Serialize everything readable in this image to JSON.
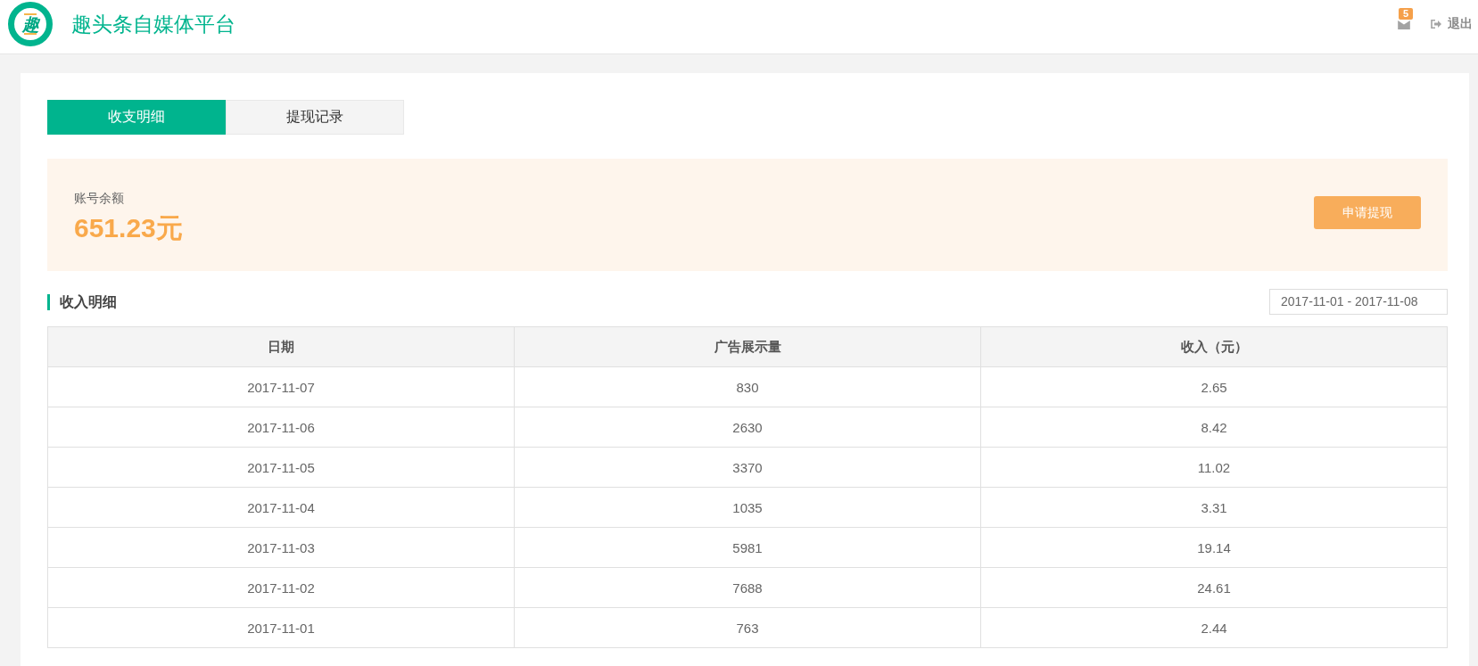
{
  "header": {
    "logo": "趣",
    "title": "趣头条自媒体平台",
    "notifications": {
      "count": "5"
    },
    "logout": "退出"
  },
  "tabs": [
    {
      "label": "收支明细",
      "selected": true
    },
    {
      "label": "提现记录",
      "selected": false
    }
  ],
  "balance": {
    "label": "账号余额",
    "amount": "651.23元",
    "button": "申请提现"
  },
  "income": {
    "title": "收入明细",
    "date_range": "2017-11-01 - 2017-11-08",
    "table": {
      "columns": [
        "日期",
        "广告展示量",
        "收入（元）"
      ],
      "rows": [
        [
          "2017-11-07",
          "830",
          "2.65"
        ],
        [
          "2017-11-06",
          "2630",
          "8.42"
        ],
        [
          "2017-11-05",
          "3370",
          "11.02"
        ],
        [
          "2017-11-04",
          "1035",
          "3.31"
        ],
        [
          "2017-11-03",
          "5981",
          "19.14"
        ],
        [
          "2017-11-02",
          "7688",
          "24.61"
        ],
        [
          "2017-11-01",
          "763",
          "2.44"
        ]
      ]
    }
  }
}
